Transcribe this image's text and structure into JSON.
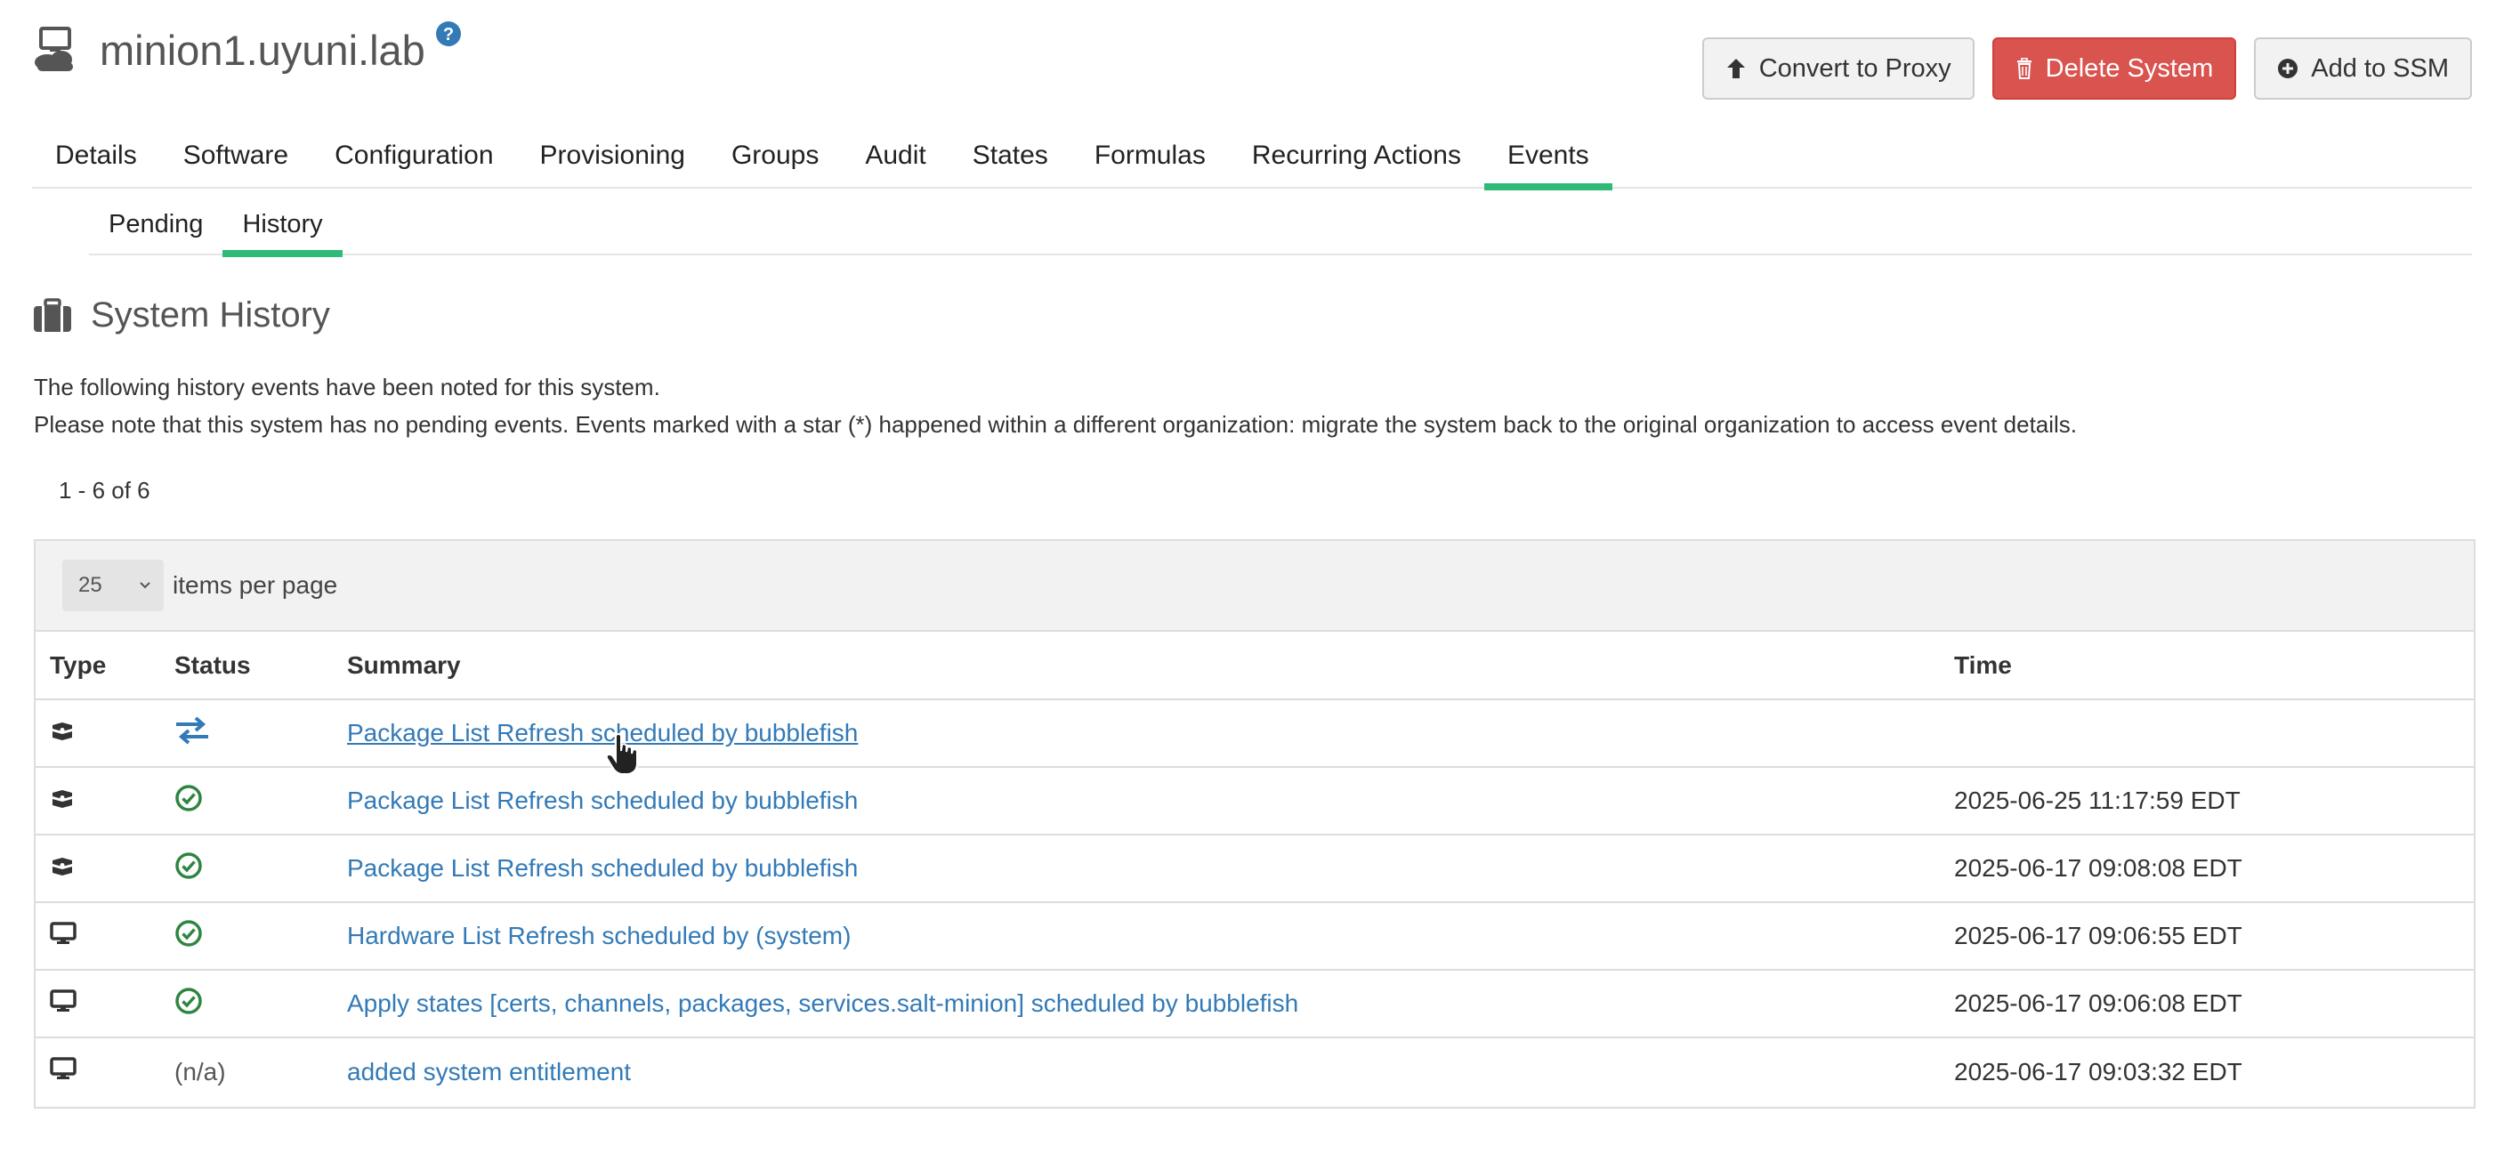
{
  "header": {
    "title": "minion1.uyuni.lab",
    "icons": {
      "system": "system-icon",
      "help": "help-icon"
    },
    "actions": [
      {
        "label": "Convert to Proxy",
        "icon": "arrow-up-icon",
        "style": "default"
      },
      {
        "label": "Delete System",
        "icon": "trash-icon",
        "style": "danger"
      },
      {
        "label": "Add to SSM",
        "icon": "plus-circle-icon",
        "style": "default"
      }
    ]
  },
  "tabs": [
    "Details",
    "Software",
    "Configuration",
    "Provisioning",
    "Groups",
    "Audit",
    "States",
    "Formulas",
    "Recurring Actions",
    "Events"
  ],
  "active_tab": "Events",
  "subtabs": [
    "Pending",
    "History"
  ],
  "active_subtab": "History",
  "section": {
    "title": "System History",
    "icon": "briefcase-icon",
    "desc1": "The following history events have been noted for this system.",
    "desc2": "Please note that this system has no pending events. Events marked with a star (*) happened within a different organization: migrate the system back to the original organization to access event details."
  },
  "pagination": {
    "count": "1 - 6 of 6",
    "per_page_value": "25",
    "per_page_label": "items per page"
  },
  "table": {
    "headers": {
      "type": "Type",
      "status": "Status",
      "summary": "Summary",
      "time": "Time"
    },
    "rows": [
      {
        "type_icon": "package-icon",
        "status_icon": "exchange-icon",
        "status_text": "",
        "summary": "Package List Refresh scheduled by bubblefish",
        "time": ""
      },
      {
        "type_icon": "package-icon",
        "status_icon": "check-circle-icon",
        "status_text": "",
        "summary": "Package List Refresh scheduled by bubblefish",
        "time": "2025-06-25 11:17:59 EDT"
      },
      {
        "type_icon": "package-icon",
        "status_icon": "check-circle-icon",
        "status_text": "",
        "summary": "Package List Refresh scheduled by bubblefish",
        "time": "2025-06-17 09:08:08 EDT"
      },
      {
        "type_icon": "desktop-icon",
        "status_icon": "check-circle-icon",
        "status_text": "",
        "summary": "Hardware List Refresh scheduled by (system)",
        "time": "2025-06-17 09:06:55 EDT"
      },
      {
        "type_icon": "desktop-icon",
        "status_icon": "check-circle-icon",
        "status_text": "",
        "summary": "Apply states [certs, channels, packages, services.salt-minion] scheduled by bubblefish",
        "time": "2025-06-17 09:06:08 EDT"
      },
      {
        "type_icon": "desktop-icon",
        "status_icon": "",
        "status_text": "(n/a)",
        "summary": "added system entitlement",
        "time": "2025-06-17 09:03:32 EDT"
      }
    ]
  },
  "colors": {
    "accent": "#30ba78",
    "link": "#337ab7",
    "danger": "#d9534f",
    "success": "#2e8540"
  }
}
